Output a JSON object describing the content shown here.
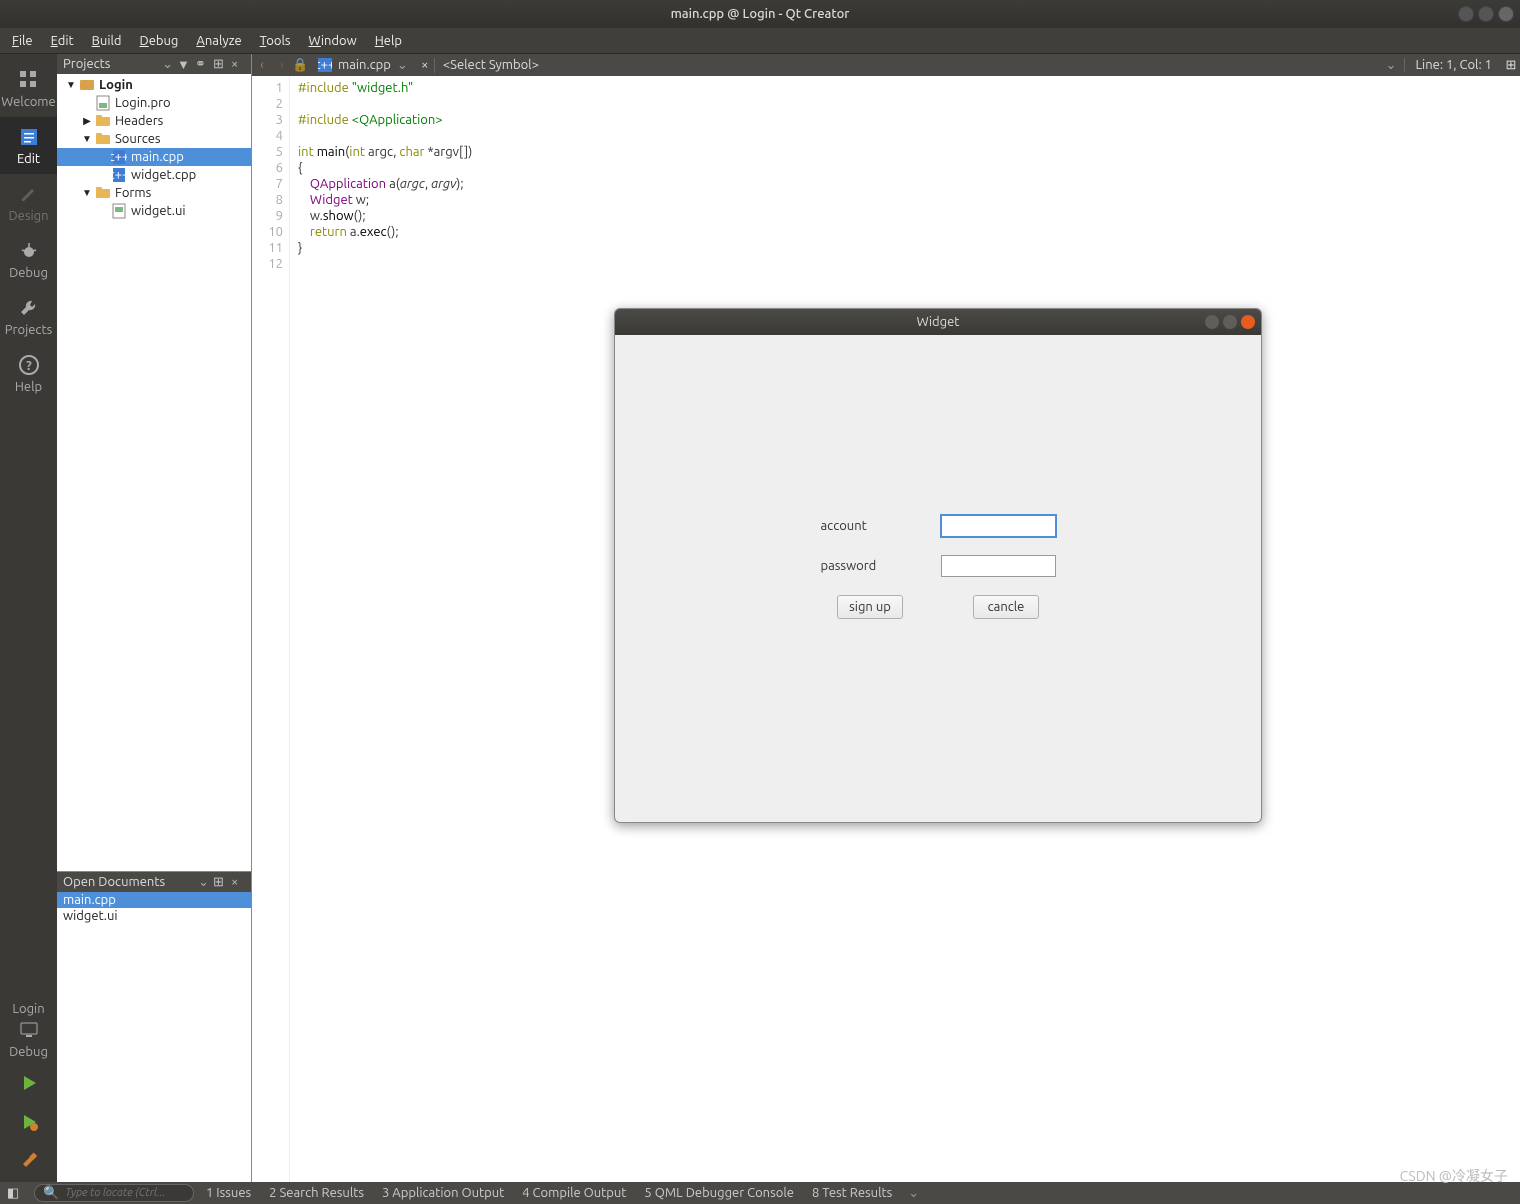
{
  "window": {
    "title": "main.cpp @ Login - Qt Creator"
  },
  "menu": {
    "items": [
      "File",
      "Edit",
      "Build",
      "Debug",
      "Analyze",
      "Tools",
      "Window",
      "Help"
    ]
  },
  "sidebar": {
    "items": [
      {
        "label": "Welcome",
        "icon": "grid"
      },
      {
        "label": "Edit",
        "icon": "edit",
        "active": true
      },
      {
        "label": "Design",
        "icon": "design"
      },
      {
        "label": "Debug",
        "icon": "bug"
      },
      {
        "label": "Projects",
        "icon": "wrench"
      },
      {
        "label": "Help",
        "icon": "help"
      }
    ],
    "bottom": [
      {
        "label": "Login",
        "sub": ""
      },
      {
        "label": "Debug",
        "icon": "monitor"
      }
    ],
    "run_icons": [
      "run",
      "run-debug",
      "hammer"
    ]
  },
  "projects_panel": {
    "title": "Projects",
    "tree": [
      {
        "indent": 0,
        "expander": "▼",
        "icon": "project",
        "label": "Login",
        "bold": true
      },
      {
        "indent": 1,
        "expander": "",
        "icon": "pro",
        "label": "Login.pro"
      },
      {
        "indent": 1,
        "expander": "▶",
        "icon": "folder",
        "label": "Headers"
      },
      {
        "indent": 1,
        "expander": "▼",
        "icon": "folder",
        "label": "Sources"
      },
      {
        "indent": 2,
        "expander": "",
        "icon": "cpp",
        "label": "main.cpp",
        "selected": true
      },
      {
        "indent": 2,
        "expander": "",
        "icon": "cpp",
        "label": "widget.cpp"
      },
      {
        "indent": 1,
        "expander": "▼",
        "icon": "folder",
        "label": "Forms"
      },
      {
        "indent": 2,
        "expander": "",
        "icon": "ui",
        "label": "widget.ui"
      }
    ]
  },
  "open_documents": {
    "title": "Open Documents",
    "items": [
      {
        "label": "main.cpp",
        "selected": true
      },
      {
        "label": "widget.ui"
      }
    ]
  },
  "editor": {
    "file_name": "main.cpp",
    "symbol_selector": "<Select Symbol>",
    "position": "Line: 1, Col: 1",
    "lines": [
      {
        "n": 1,
        "html": "<span class='kw'>#include</span> <span class='inc'>\"widget.h\"</span>"
      },
      {
        "n": 2,
        "html": ""
      },
      {
        "n": 3,
        "html": "<span class='kw'>#include</span> <span class='inc'>&lt;QApplication&gt;</span>"
      },
      {
        "n": 4,
        "html": ""
      },
      {
        "n": 5,
        "html": "<span class='kw'>int</span> <span class='func'>main</span>(<span class='kw'>int</span> argc, <span class='kw'>char</span> *argv[])"
      },
      {
        "n": 6,
        "html": "{"
      },
      {
        "n": 7,
        "html": "    <span class='type'>QApplication</span> a(<span class='arg'>argc</span>, <span class='arg'>argv</span>);"
      },
      {
        "n": 8,
        "html": "    <span class='type'>Widget</span> w;"
      },
      {
        "n": 9,
        "html": "    w.<span class='func'>show</span>();"
      },
      {
        "n": 10,
        "html": "    <span class='kw'>return</span> a.<span class='func'>exec</span>();"
      },
      {
        "n": 11,
        "html": "}"
      },
      {
        "n": 12,
        "html": ""
      }
    ]
  },
  "popup": {
    "title": "Widget",
    "account_label": "account",
    "password_label": "password",
    "signup_label": "sign up",
    "cancel_label": "cancle"
  },
  "statusbar": {
    "locator_placeholder": "Type to locate (Ctrl...",
    "tabs": [
      "1  Issues",
      "2  Search Results",
      "3  Application Output",
      "4  Compile Output",
      "5  QML Debugger Console",
      "8  Test Results"
    ]
  },
  "watermark": "CSDN @冷凝女子"
}
